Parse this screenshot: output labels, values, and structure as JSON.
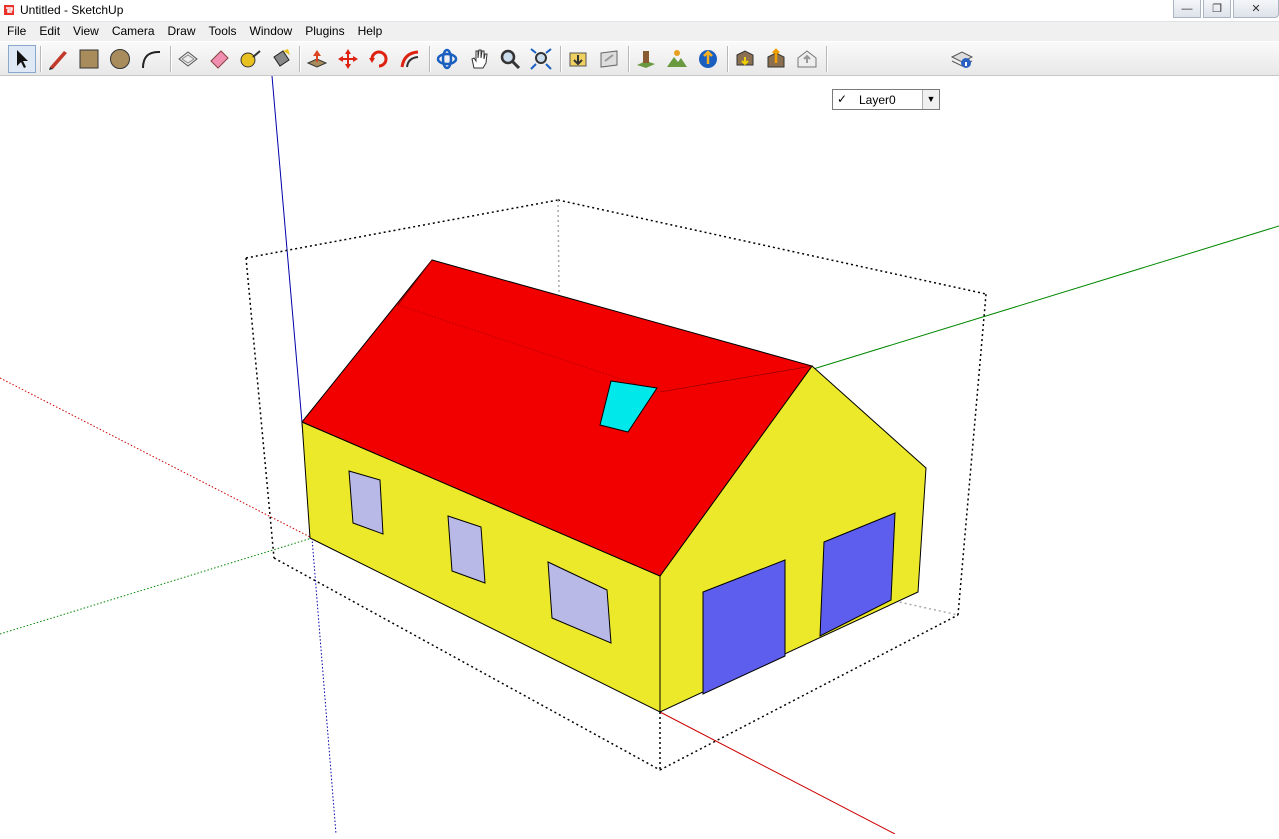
{
  "window": {
    "title": "Untitled - SketchUp"
  },
  "menu": {
    "items": [
      "File",
      "Edit",
      "View",
      "Camera",
      "Draw",
      "Tools",
      "Window",
      "Plugins",
      "Help"
    ]
  },
  "toolbar": {
    "tools": [
      "select",
      "line",
      "rectangle",
      "circle",
      "arc",
      "make-component",
      "eraser",
      "tape-measure",
      "paint-bucket",
      "push-pull",
      "move",
      "rotate",
      "follow-me",
      "orbit",
      "pan",
      "zoom",
      "zoom-extents",
      "get-models",
      "share-model",
      "add-location",
      "toggle-terrain",
      "google-earth",
      "photo-textures",
      "get-photo-texture",
      "3d-warehouse",
      "layer-manager"
    ],
    "layer": {
      "selected": "Layer0",
      "visible": true
    }
  },
  "scene": {
    "roof_color": "#f20000",
    "wall_color": "#ebe92a",
    "window_color": "#b9b9e8",
    "door_color": "#5e5eee",
    "skylight_color": "#00e8ea",
    "axis_colors": {
      "x": "#cc0000",
      "y": "#008800",
      "z": "#0000aa"
    }
  }
}
